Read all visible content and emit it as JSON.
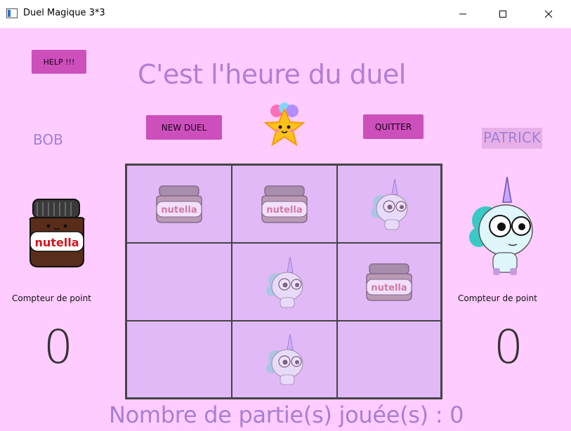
{
  "window": {
    "title": "Duel Magique 3*3",
    "controls": [
      "minimize",
      "maximize",
      "close"
    ]
  },
  "header": {
    "help_label": "HELP !!!",
    "title": "C'est l'heure du duel",
    "new_duel_label": "NEW DUEL",
    "quit_label": "QUITTER"
  },
  "players": {
    "left": {
      "name": "BOB",
      "avatar_icon": "nutella-jar-icon",
      "counter_label": "Compteur de point",
      "score": "0"
    },
    "right": {
      "name": "PATRICK",
      "avatar_icon": "unicorn-icon",
      "counter_label": "Compteur de point",
      "score": "0"
    }
  },
  "board": {
    "cells": [
      "nutella",
      "nutella",
      "unicorn",
      "",
      "unicorn",
      "nutella",
      "",
      "unicorn",
      ""
    ]
  },
  "footer": {
    "games_played": "Nombre de partie(s) jouée(s) : 0"
  },
  "colors": {
    "background": "#ffccff",
    "button": "#cc4fbb",
    "heading": "#b07fd4",
    "board_cell": "#e1b9f7"
  }
}
